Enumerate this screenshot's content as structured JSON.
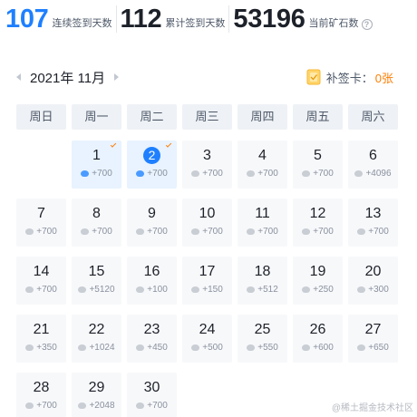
{
  "stats": {
    "consecutive_days": "107",
    "consecutive_label": "连续签到天数",
    "total_days": "112",
    "total_label": "累计签到天数",
    "ore_count": "53196",
    "ore_label": "当前矿石数",
    "help_icon_glyph": "?"
  },
  "calendar_header": {
    "month": "2021年 11月",
    "makeup_label": "补签卡：",
    "makeup_count": "0张"
  },
  "weekdays": [
    "周日",
    "周一",
    "周二",
    "周三",
    "周四",
    "周五",
    "周六"
  ],
  "leading_empty_days": 1,
  "days": [
    {
      "day": "1",
      "reward": "+700",
      "signed": true,
      "today": false
    },
    {
      "day": "2",
      "reward": "+700",
      "signed": true,
      "today": true
    },
    {
      "day": "3",
      "reward": "+700",
      "signed": false,
      "today": false
    },
    {
      "day": "4",
      "reward": "+700",
      "signed": false,
      "today": false
    },
    {
      "day": "5",
      "reward": "+700",
      "signed": false,
      "today": false
    },
    {
      "day": "6",
      "reward": "+4096",
      "signed": false,
      "today": false
    },
    {
      "day": "7",
      "reward": "+700",
      "signed": false,
      "today": false
    },
    {
      "day": "8",
      "reward": "+700",
      "signed": false,
      "today": false
    },
    {
      "day": "9",
      "reward": "+700",
      "signed": false,
      "today": false
    },
    {
      "day": "10",
      "reward": "+700",
      "signed": false,
      "today": false
    },
    {
      "day": "11",
      "reward": "+700",
      "signed": false,
      "today": false
    },
    {
      "day": "12",
      "reward": "+700",
      "signed": false,
      "today": false
    },
    {
      "day": "13",
      "reward": "+700",
      "signed": false,
      "today": false
    },
    {
      "day": "14",
      "reward": "+700",
      "signed": false,
      "today": false
    },
    {
      "day": "15",
      "reward": "+5120",
      "signed": false,
      "today": false
    },
    {
      "day": "16",
      "reward": "+100",
      "signed": false,
      "today": false
    },
    {
      "day": "17",
      "reward": "+150",
      "signed": false,
      "today": false
    },
    {
      "day": "18",
      "reward": "+512",
      "signed": false,
      "today": false
    },
    {
      "day": "19",
      "reward": "+250",
      "signed": false,
      "today": false
    },
    {
      "day": "20",
      "reward": "+300",
      "signed": false,
      "today": false
    },
    {
      "day": "21",
      "reward": "+350",
      "signed": false,
      "today": false
    },
    {
      "day": "22",
      "reward": "+1024",
      "signed": false,
      "today": false
    },
    {
      "day": "23",
      "reward": "+450",
      "signed": false,
      "today": false
    },
    {
      "day": "24",
      "reward": "+500",
      "signed": false,
      "today": false
    },
    {
      "day": "25",
      "reward": "+550",
      "signed": false,
      "today": false
    },
    {
      "day": "26",
      "reward": "+600",
      "signed": false,
      "today": false
    },
    {
      "day": "27",
      "reward": "+650",
      "signed": false,
      "today": false
    },
    {
      "day": "28",
      "reward": "+700",
      "signed": false,
      "today": false
    },
    {
      "day": "29",
      "reward": "+2048",
      "signed": false,
      "today": false
    },
    {
      "day": "30",
      "reward": "+700",
      "signed": false,
      "today": false
    }
  ],
  "watermark": "@稀土掘金技术社区",
  "colors": {
    "accent": "#1e80ff",
    "signed_bg": "#e8f3ff",
    "check_mark": "#ff7d00",
    "makeup_count": "#ff7d00"
  },
  "icons": {
    "reward": "ore-icon",
    "signed_marker": "check-icon",
    "makeup_card": "card-icon"
  }
}
